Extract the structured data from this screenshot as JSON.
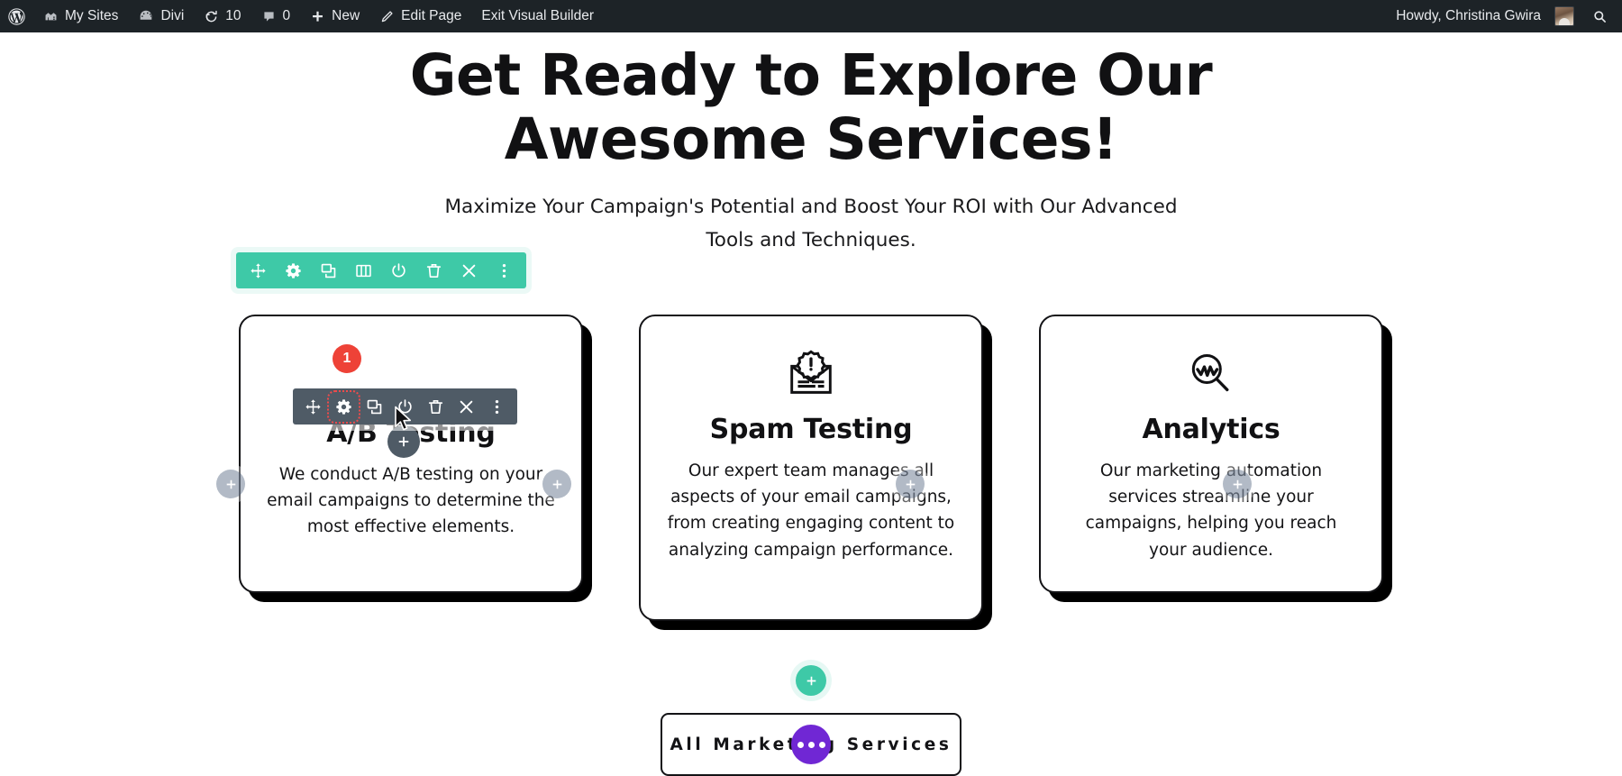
{
  "adminbar": {
    "items": [
      {
        "icon": "wordpress-logo-icon",
        "label": ""
      },
      {
        "icon": "my-sites-icon",
        "label": "My Sites"
      },
      {
        "icon": "divi-icon",
        "label": "Divi"
      },
      {
        "icon": "updates-icon",
        "label": "10"
      },
      {
        "icon": "comments-icon",
        "label": "0"
      },
      {
        "icon": "new-content-icon",
        "label": "New"
      },
      {
        "icon": "edit-page-icon",
        "label": "Edit Page"
      },
      {
        "icon": "",
        "label": "Exit Visual Builder"
      }
    ],
    "howdy": "Howdy, Christina Gwira",
    "search_icon": "search-icon",
    "background": "#1d2327"
  },
  "hero": {
    "heading": "Get Ready to Explore Our Awesome Services!",
    "subheading": "Maximize Your Campaign's Potential and Boost Your ROI with Our Advanced Tools and Techniques."
  },
  "row_toolbar": {
    "color": "#3ec9a7",
    "buttons": [
      {
        "name": "move-icon",
        "title": "Drag Row"
      },
      {
        "name": "gear-icon",
        "title": "Row Settings"
      },
      {
        "name": "duplicate-icon",
        "title": "Duplicate Row"
      },
      {
        "name": "columns-icon",
        "title": "Change Column Structure"
      },
      {
        "name": "power-icon",
        "title": "Disable Row"
      },
      {
        "name": "trash-icon",
        "title": "Delete Row"
      },
      {
        "name": "close-icon",
        "title": "Collapse"
      },
      {
        "name": "more-options-icon",
        "title": "More Options"
      }
    ]
  },
  "module_toolbar": {
    "color": "#4f5b66",
    "badge": "1",
    "highlighted": "gear-icon",
    "buttons": [
      {
        "name": "move-icon",
        "title": "Drag Module"
      },
      {
        "name": "gear-icon",
        "title": "Module Settings"
      },
      {
        "name": "duplicate-icon",
        "title": "Duplicate Module"
      },
      {
        "name": "power-icon",
        "title": "Disable Module"
      },
      {
        "name": "trash-icon",
        "title": "Delete Module"
      },
      {
        "name": "close-icon",
        "title": "Collapse"
      },
      {
        "name": "more-options-icon",
        "title": "More Options"
      }
    ],
    "add_module_label": "+"
  },
  "cards": [
    {
      "icon": "",
      "title": "A/B Testing",
      "text": "We conduct A/B testing on your email campaigns to determine the most effective elements."
    },
    {
      "icon": "spam-envelope-icon",
      "title": "Spam Testing",
      "text": "Our expert team manages all aspects of your email campaigns, from creating engaging content to analyzing campaign performance."
    },
    {
      "icon": "analytics-magnifier-icon",
      "title": "Analytics",
      "text": "Our marketing automation services streamline your campaigns, helping you reach your audience."
    }
  ],
  "plus_buttons": {
    "label": "+",
    "color": "rgba(130,143,163,0.62)"
  },
  "add_row_button": {
    "label": "+",
    "color": "#3ec9a7"
  },
  "cta": {
    "label": "All Marketing Services",
    "loading": true,
    "spinner_color": "#7027d4"
  }
}
